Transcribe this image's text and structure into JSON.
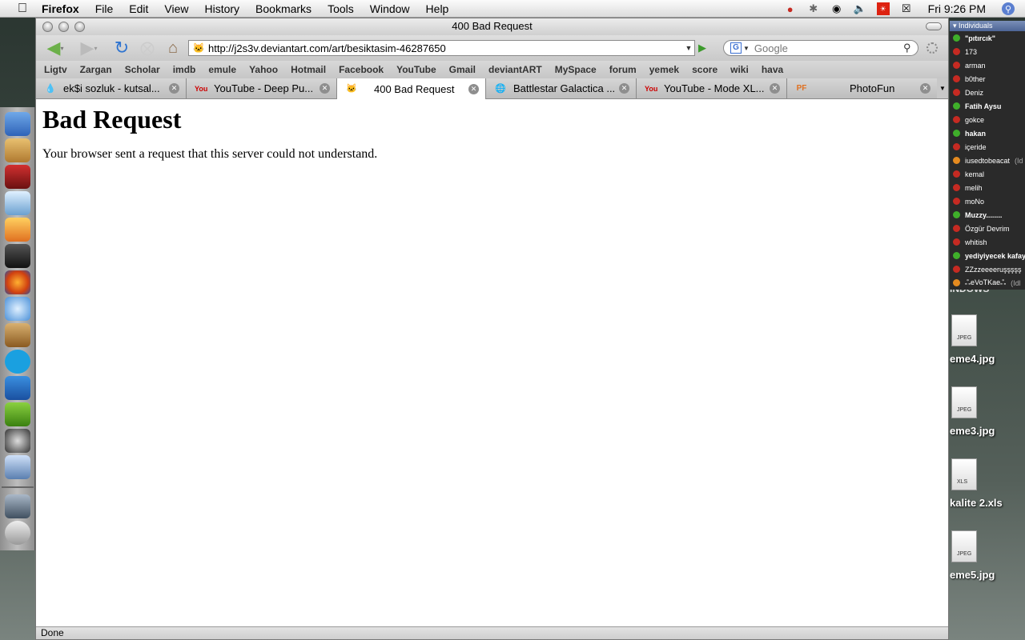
{
  "menubar": {
    "app": "Firefox",
    "items": [
      "File",
      "Edit",
      "View",
      "History",
      "Bookmarks",
      "Tools",
      "Window",
      "Help"
    ],
    "clock": "Fri 9:26 PM"
  },
  "window": {
    "title": "400 Bad Request",
    "url": "http://j2s3v.deviantart.com/art/besiktasim-46287650",
    "search_placeholder": "Google"
  },
  "bookmarks": [
    "Ligtv",
    "Zargan",
    "Scholar",
    "imdb",
    "emule",
    "Yahoo",
    "Hotmail",
    "Facebook",
    "YouTube",
    "Gmail",
    "deviantART",
    "MySpace",
    "forum",
    "yemek",
    "score",
    "wiki",
    "hava"
  ],
  "tabs": [
    {
      "title": "ek$i sozluk - kutsal...",
      "icon": "droplet-icon",
      "selected": false
    },
    {
      "title": "YouTube - Deep Pu...",
      "icon": "youtube-icon",
      "selected": false
    },
    {
      "title": "400 Bad Request",
      "icon": "deviantart-icon",
      "selected": true
    },
    {
      "title": "Battlestar Galactica ...",
      "icon": "globe-icon",
      "selected": false
    },
    {
      "title": "YouTube - Mode XL...",
      "icon": "youtube-icon",
      "selected": false
    },
    {
      "title": "PhotoFun",
      "icon": "photofun-icon",
      "selected": false
    }
  ],
  "page": {
    "heading": "Bad Request",
    "message": "Your browser sent a request that this server could not understand."
  },
  "status": "Done",
  "im_panel": {
    "header": "Individuals",
    "contacts": [
      {
        "name": "\"pıtırcık\"",
        "status": "green",
        "bold": true
      },
      {
        "name": "173",
        "status": "red",
        "bold": false
      },
      {
        "name": "arman",
        "status": "red",
        "bold": false
      },
      {
        "name": "b0ther",
        "status": "red",
        "bold": false
      },
      {
        "name": "Deniz",
        "status": "red",
        "bold": false
      },
      {
        "name": "Fatih Aysu",
        "status": "green",
        "bold": true
      },
      {
        "name": "gokce",
        "status": "red",
        "bold": false
      },
      {
        "name": "hakan",
        "status": "green",
        "bold": true
      },
      {
        "name": "içeride",
        "status": "red",
        "bold": false
      },
      {
        "name": "iusedtobeacat",
        "status": "orange",
        "bold": false,
        "away": "(Id"
      },
      {
        "name": "kemal",
        "status": "red",
        "bold": false
      },
      {
        "name": "melih",
        "status": "red",
        "bold": false
      },
      {
        "name": "moNo",
        "status": "red",
        "bold": false
      },
      {
        "name": "Muzzy........",
        "status": "green",
        "bold": true
      },
      {
        "name": "Özgür Devrim",
        "status": "red",
        "bold": false
      },
      {
        "name": "whitish",
        "status": "red",
        "bold": false
      },
      {
        "name": "yediyiyecek kafay",
        "status": "green",
        "bold": true
      },
      {
        "name": "ZZzzeeeeruşşşşş",
        "status": "red",
        "bold": false
      },
      {
        "name": "ஃeVoTKaeஃ",
        "status": "orange",
        "bold": false,
        "away": "(Idl"
      }
    ]
  },
  "desktop": {
    "fragment": "INDOWS",
    "files": [
      {
        "label": "eme4.jpg",
        "type": "JPEG"
      },
      {
        "label": "eme3.jpg",
        "type": "JPEG"
      },
      {
        "label": "kalite 2.xls",
        "type": "XLS"
      },
      {
        "label": "eme5.jpg",
        "type": "JPEG"
      }
    ]
  },
  "colors": {
    "status_green": "#3fae2a",
    "status_red": "#c62a22",
    "status_orange": "#e58a1f"
  }
}
